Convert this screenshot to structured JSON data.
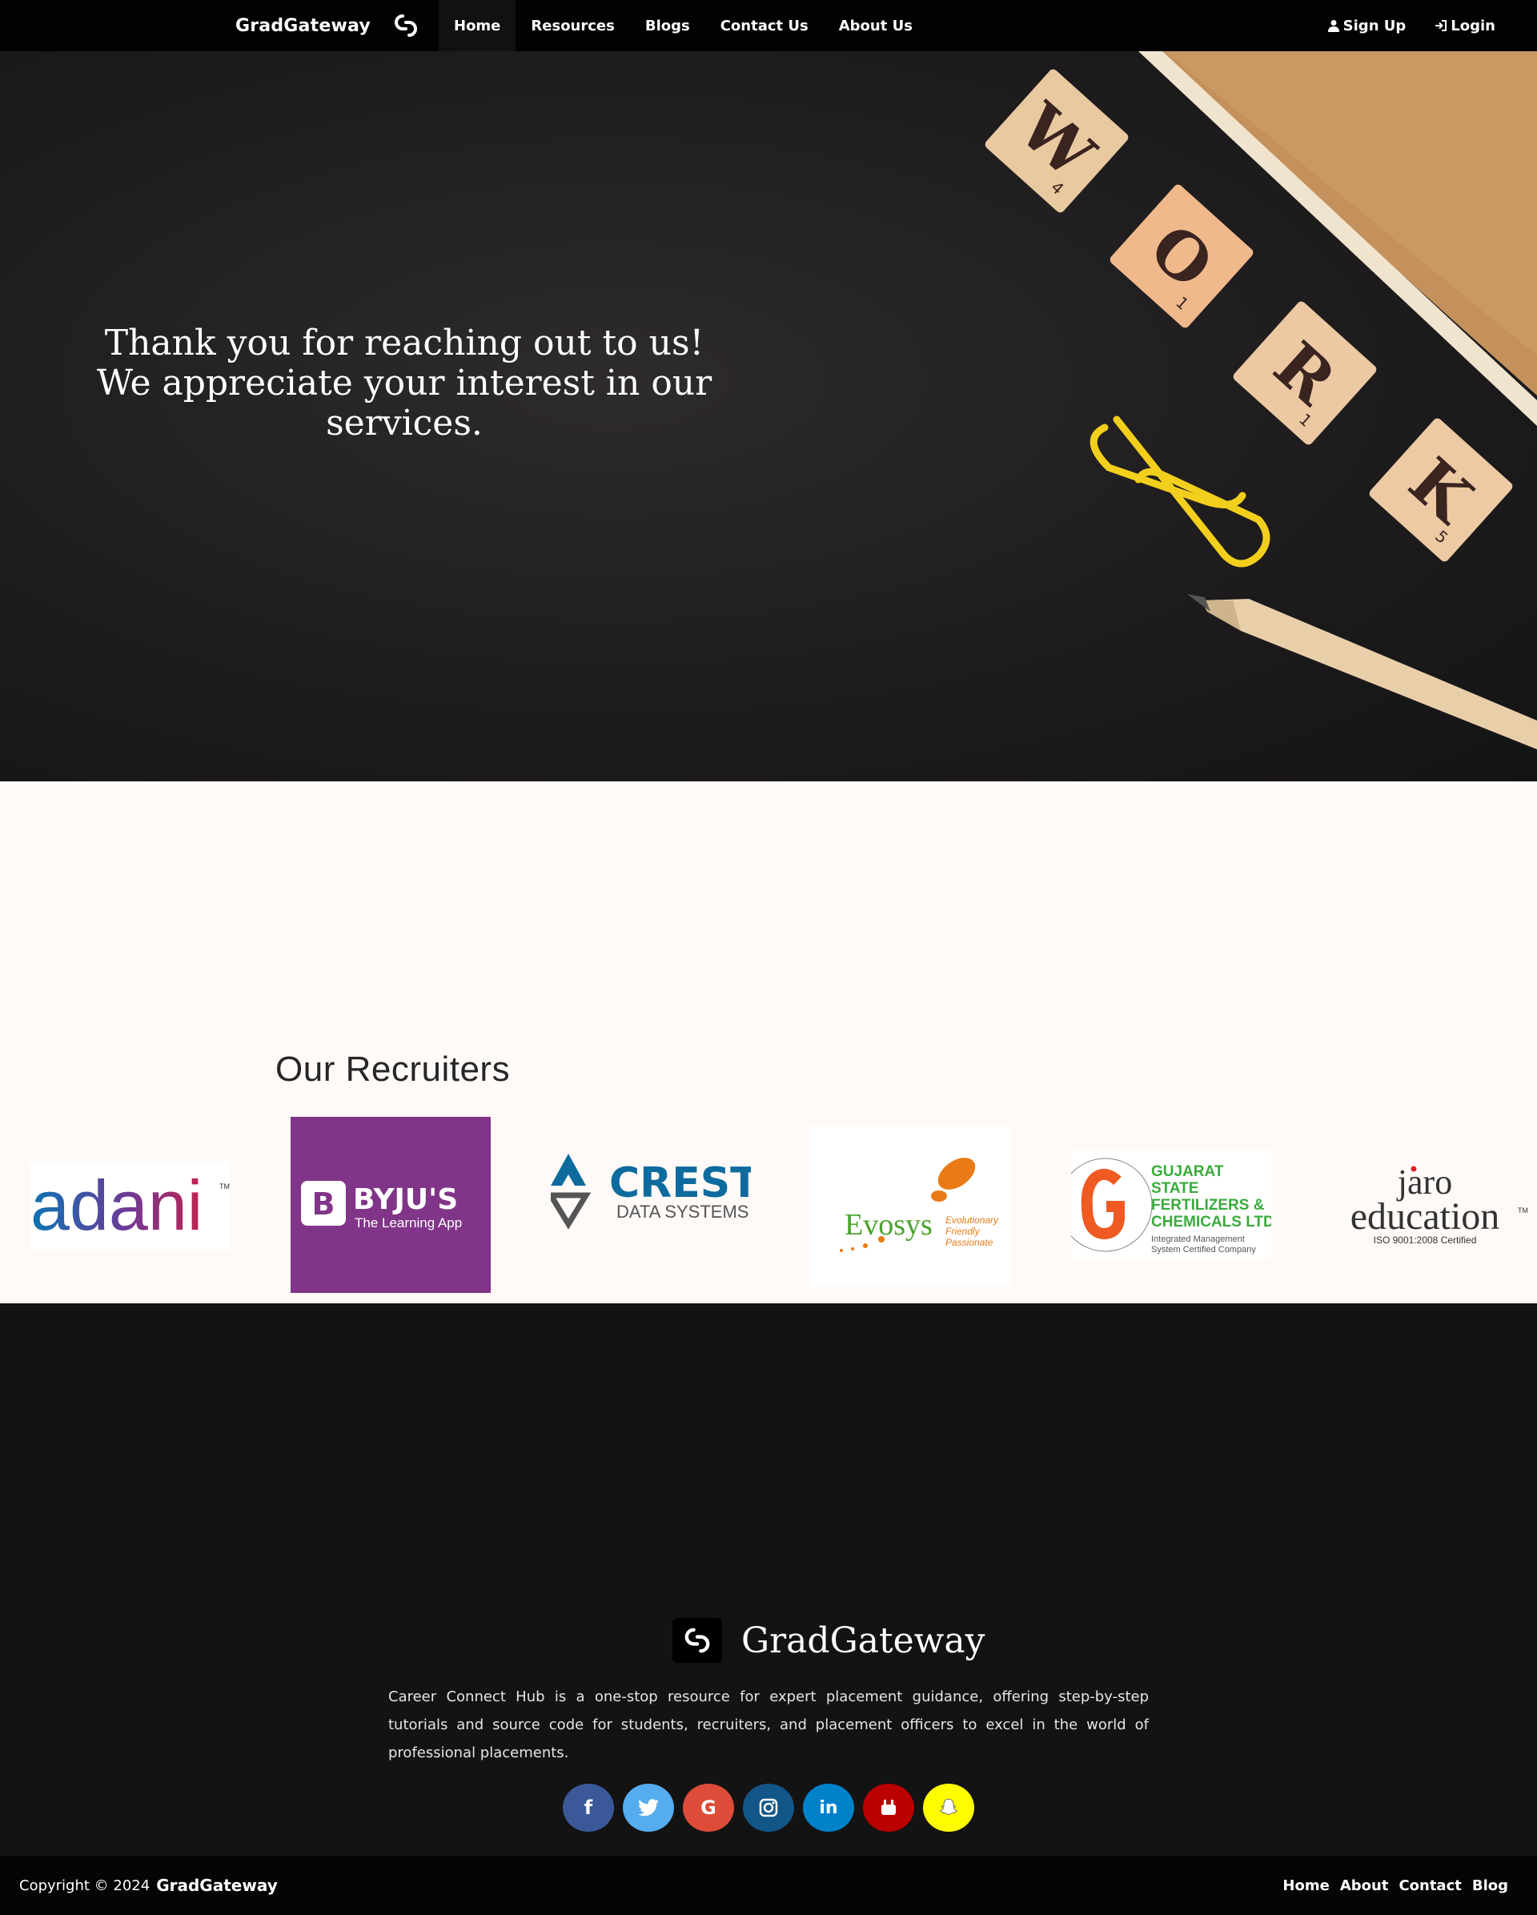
{
  "navbar": {
    "brand": "GradGateway",
    "links": [
      {
        "label": "Home"
      },
      {
        "label": "Resources"
      },
      {
        "label": "Blogs"
      },
      {
        "label": "Contact Us"
      },
      {
        "label": "About Us"
      }
    ],
    "signup": "Sign Up",
    "login": "Login"
  },
  "hero": {
    "line1": "Thank you for reaching out to us!",
    "line2": "We appreciate your interest in our",
    "line3": "services.",
    "tiles": [
      {
        "letter": "W",
        "score": "4"
      },
      {
        "letter": "O",
        "score": "1"
      },
      {
        "letter": "R",
        "score": "1"
      },
      {
        "letter": "K",
        "score": "5"
      }
    ]
  },
  "recruiters": {
    "heading": "Our Recruiters",
    "logos": {
      "adani": {
        "name": "adani",
        "tm": "TM"
      },
      "byjus": {
        "name": "BYJU'S",
        "tagline": "The Learning App"
      },
      "crest": {
        "name": "CREST",
        "sub": "DATA SYSTEMS"
      },
      "evosys": {
        "name": "Evosys",
        "tag1": "Evolutionary",
        "tag2": "Friendly",
        "tag3": "Passionate"
      },
      "gsfc": {
        "l1": "GUJARAT",
        "l2": "STATE",
        "l3": "FERTILIZERS &",
        "l4": "CHEMICALS LTD.",
        "l5": "Integrated Management",
        "l6": "System Certified Company"
      },
      "jaro": {
        "l1": "jaro",
        "l2": "education",
        "tm": "TM",
        "cert": "ISO 9001:2008 Certified"
      }
    }
  },
  "footer": {
    "brand": "GradGateway",
    "description": "Career Connect Hub is a one-stop resource for expert placement guidance, offering step-by-step tutorials and source code for students, recruiters, and placement officers to excel in the world of professional placements.",
    "socials": [
      {
        "icon": "facebook-icon",
        "glyph": "f",
        "color": "#3b5998"
      },
      {
        "icon": "twitter-icon",
        "glyph": "",
        "color": "#55acee"
      },
      {
        "icon": "google-icon",
        "glyph": "G",
        "color": "#dd4b39"
      },
      {
        "icon": "instagram-icon",
        "glyph": "",
        "color": "#125688"
      },
      {
        "icon": "linkedin-icon",
        "glyph": "in",
        "color": "#0082ca"
      },
      {
        "icon": "youtube-icon",
        "glyph": "",
        "color": "#bb0000"
      },
      {
        "icon": "snapchat-icon",
        "glyph": "",
        "color": "#fffc00"
      }
    ]
  },
  "bottom": {
    "copyright": "Copyright © 2024",
    "brand": "GradGateway",
    "links": [
      "Home",
      "About",
      "Contact",
      "Blog"
    ]
  }
}
